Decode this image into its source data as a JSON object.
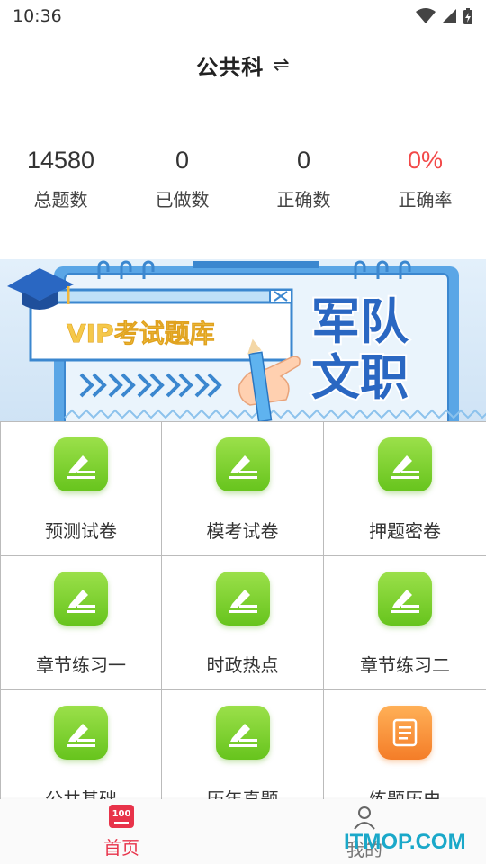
{
  "status_bar": {
    "time": "10:36"
  },
  "header": {
    "title": "公共科",
    "switch_icon": "⇌"
  },
  "stats": [
    {
      "value": "14580",
      "label": "总题数"
    },
    {
      "value": "0",
      "label": "已做数"
    },
    {
      "value": "0",
      "label": "正确数"
    },
    {
      "value": "0%",
      "label": "正确率",
      "color": "#f24848"
    }
  ],
  "banner": {
    "vip_text": "VIP考试题库",
    "title_line1": "军队",
    "title_line2": "文职"
  },
  "grid": [
    {
      "label": "预测试卷",
      "icon": "pencil-icon"
    },
    {
      "label": "模考试卷",
      "icon": "pencil-icon"
    },
    {
      "label": "押题密卷",
      "icon": "pencil-icon"
    },
    {
      "label": "章节练习一",
      "icon": "pencil-icon"
    },
    {
      "label": "时政热点",
      "icon": "pencil-icon"
    },
    {
      "label": "章节练习二",
      "icon": "pencil-icon"
    },
    {
      "label": "公共基础",
      "icon": "pencil-icon"
    },
    {
      "label": "历年真题",
      "icon": "pencil-icon"
    },
    {
      "label": "练题历史",
      "icon": "history-list-icon"
    }
  ],
  "tabbar": {
    "home_icon_text": "100",
    "home_label": "首页",
    "mine_label": "我的"
  },
  "watermark": "ITMOP.COM",
  "colors": {
    "accent": "#e8334a",
    "green": "#7ed03a",
    "orange": "#f7903a",
    "rate_red": "#f24848"
  }
}
